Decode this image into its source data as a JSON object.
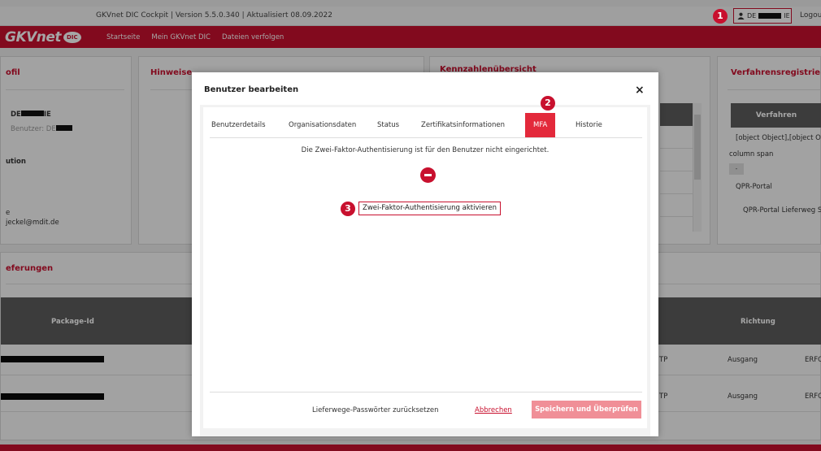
{
  "topbar": {
    "version_text": "GKVnet DIC Cockpit  |  Version 5.5.0.340  |  Aktualisiert 08.09.2022",
    "user_prefix": "DE",
    "user_suffix": "IE",
    "logout": "Logou"
  },
  "logo": {
    "brand": "GKVnet",
    "badge": "DIC"
  },
  "nav": {
    "items": [
      "Startseite",
      "Mein GKVnet DIC",
      "Dateien verfolgen"
    ]
  },
  "background": {
    "profil_title": "ofil",
    "profil_name_prefix": "DE",
    "profil_name_suffix": "IE",
    "profil_user_label": "Benutzer: DE",
    "institution_label": "ution",
    "email_label": "e",
    "email_value": "jeckel@mdit.de",
    "hinweise_title": "Hinweise",
    "kennzahlen_title": "Kennzahlenübersicht",
    "verfahren_title": "Verfahrensregistrierung",
    "verfahren_header": "Verfahren",
    "verfahren_row1": "[object Object],[object Obj",
    "verfahren_row2": "column span",
    "verfahren_row3": "QPR-Portal",
    "verfahren_row4": "QPR-Portal Lieferweg SFT",
    "verfahren_dash": "-",
    "lieferungen_title": "eferungen",
    "package_header": "Package-Id",
    "richtung_header": "Richtung",
    "rows": [
      {
        "tp": "TP",
        "richtung": "Ausgang",
        "status": "ERFO"
      },
      {
        "tp": "TP",
        "richtung": "Ausgang",
        "status": "ERFO"
      }
    ]
  },
  "modal": {
    "title": "Benutzer bearbeiten",
    "close": "×",
    "tabs": [
      "Benutzerdetails",
      "Organisationsdaten",
      "Status",
      "Zertifikatsinformationen",
      "MFA",
      "Historie"
    ],
    "info_text": "Die Zwei-Faktor-Authentisierung ist für den Benutzer nicht eingerichtet.",
    "activate_button": "Zwei-Faktor-Authentisierung aktivieren",
    "reset_link": "Lieferwege-Passwörter zurücksetzen",
    "cancel_link": "Abbrechen",
    "save_button": "Speichern und Überprüfen"
  },
  "callouts": [
    "1",
    "2",
    "3"
  ],
  "colors": {
    "brand_red": "#c8102e",
    "tab_active": "#e3293b",
    "save_disabled": "#f08f97"
  }
}
